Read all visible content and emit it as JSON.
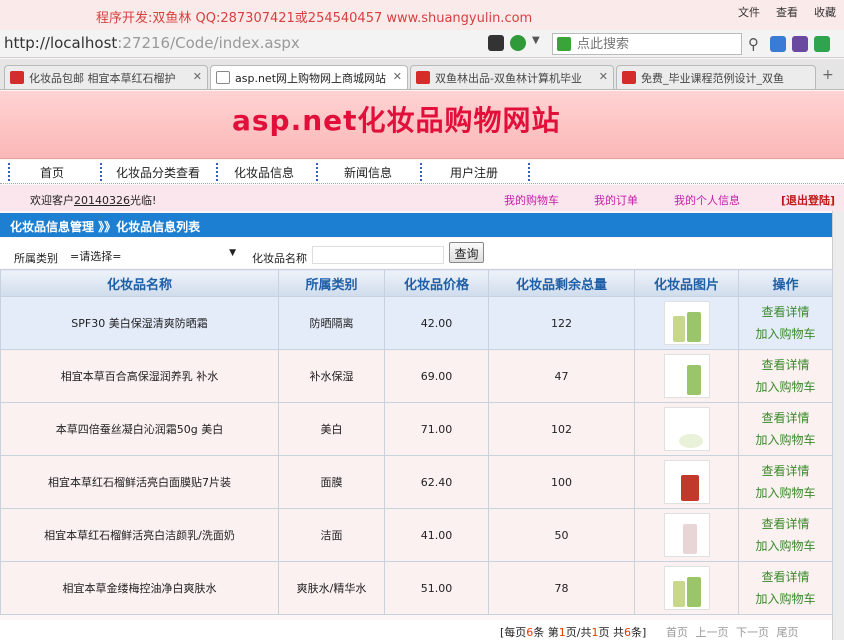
{
  "watermark": "程序开发:双鱼林 QQ:287307421或254540457 www.shuangyulin.com",
  "window_menu": [
    "文件",
    "查看",
    "收藏"
  ],
  "address_bar": {
    "url_host": "http://localhost",
    "url_path": ":27216/Code/index.aspx"
  },
  "search": {
    "placeholder": "点此搜索"
  },
  "tabs": [
    {
      "label": "化妆品包邮 相宜本草红石榴护"
    },
    {
      "label": "asp.net网上购物网上商城网站"
    },
    {
      "label": "双鱼林出品-双鱼林计算机毕业"
    },
    {
      "label": "免费_毕业课程范例设计_双鱼"
    }
  ],
  "site": {
    "title": "asp.net化妆品购物网站"
  },
  "nav": [
    "首页",
    "化妆品分类查看",
    "化妆品信息",
    "新闻信息",
    "用户注册"
  ],
  "welcome": {
    "prefix": "欢迎客户",
    "user": "20140326",
    "suffix": "光临!"
  },
  "user_links": {
    "cart": "我的购物车",
    "orders": "我的订单",
    "profile": "我的个人信息",
    "logout": "[退出登陆]"
  },
  "panel": {
    "title": "化妆品信息管理 》》化妆品信息列表"
  },
  "filter": {
    "category_label": "所属类别",
    "category_value": "=请选择=",
    "name_label": "化妆品名称",
    "name_value": "",
    "query_button": "查询"
  },
  "table": {
    "headers": [
      "化妆品名称",
      "所属类别",
      "化妆品价格",
      "化妆品剩余总量",
      "化妆品图片",
      "操作"
    ],
    "rows": [
      {
        "name": "SPF30 美白保湿清爽防晒霜",
        "category": "防晒隔离",
        "price": "42.00",
        "stock": "122"
      },
      {
        "name": "相宜本草百合高保湿润养乳 补水",
        "category": "补水保湿",
        "price": "69.00",
        "stock": "47"
      },
      {
        "name": "本草四倍蚕丝凝白沁润霜50g 美白",
        "category": "美白",
        "price": "71.00",
        "stock": "102"
      },
      {
        "name": "相宜本草红石榴鲜活亮白面膜贴7片装",
        "category": "面膜",
        "price": "62.40",
        "stock": "100"
      },
      {
        "name": "相宜本草红石榴鲜活亮白洁颜乳/洗面奶",
        "category": "洁面",
        "price": "41.00",
        "stock": "50"
      },
      {
        "name": "相宜本草金缕梅控油净白爽肤水",
        "category": "爽肤水/精华水",
        "price": "51.00",
        "stock": "78"
      }
    ],
    "action_view": "查看详情",
    "action_cart": "加入购物车"
  },
  "pager": {
    "per_page_prefix": "[每页",
    "per_page": "6",
    "per_page_suffix": "条 第",
    "page": "1",
    "page_sep": "页/共",
    "total_pages": "1",
    "page_suffix": "页 共",
    "total": "6",
    "total_suffix": "条]",
    "nav": "首页 上一页 下一页 尾页"
  }
}
